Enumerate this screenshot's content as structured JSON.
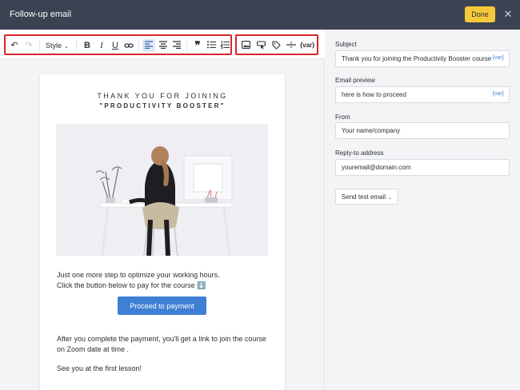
{
  "header": {
    "title": "Follow-up email",
    "done_label": "Done",
    "close_glyph": "✕"
  },
  "toolbar": {
    "undo_glyph": "↶",
    "redo_glyph": "↷",
    "style_label": "Style",
    "bold": "B",
    "italic": "I",
    "underline": "U",
    "quote_glyph": "❞",
    "var_label": "{var}"
  },
  "email": {
    "heading_line1": "THANK YOU FOR JOINING",
    "heading_line2": "\"PRODUCTIVITY BOOSTER\"",
    "body_line1": "Just one more step to optimize your working hours.",
    "body_line2": "Click the button below to pay for the course ⬇️",
    "cta_label": "Proceed to payment",
    "after_text": "After you complete the payment, you'll get a link to join the course on Zoom  date  at  time .",
    "signoff": "See you at the first lesson!"
  },
  "settings": {
    "subject_label": "Subject",
    "subject_value": "Thank you for joining the Productivity Booster course",
    "subject_var": "{var}",
    "preview_label": "Email preview",
    "preview_value": "here is how to proceed",
    "preview_var": "{var}",
    "from_label": "From",
    "from_value": "Your name/company",
    "reply_label": "Reply-to address",
    "reply_value": "youremail@domain.com",
    "test_label": "Send test email"
  },
  "colors": {
    "topbar": "#3b4252",
    "done_button": "#f5c93b",
    "cta_button": "#3f7fd4",
    "highlight_border": "#d9252a"
  }
}
